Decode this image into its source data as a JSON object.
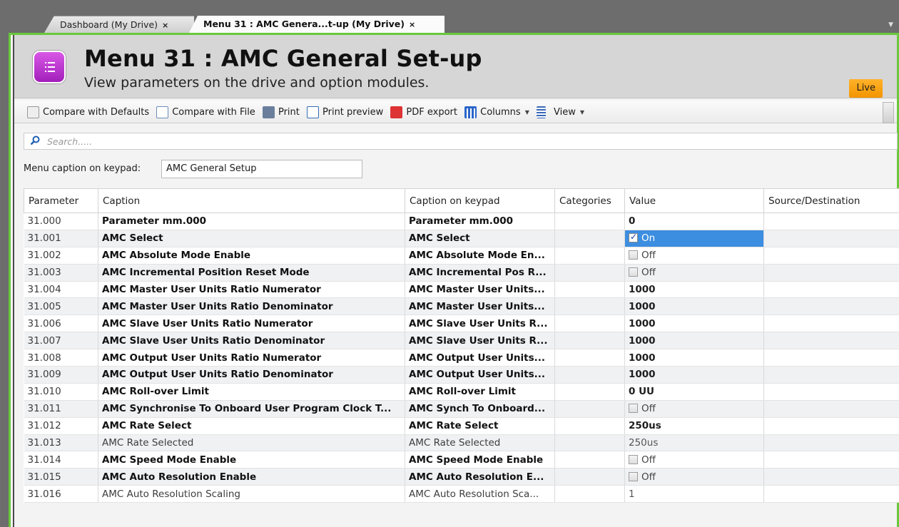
{
  "tabs": [
    {
      "label": "Dashboard (My Drive)",
      "close": "×",
      "active": false
    },
    {
      "label": "Menu 31 : AMC Genera...t-up (My Drive)",
      "close": "×",
      "active": true
    }
  ],
  "header": {
    "title": "Menu 31 : AMC General Set-up",
    "subtitle": "View parameters on the drive and option modules.",
    "icon": "menu-list-icon",
    "badge": "Live"
  },
  "colors": {
    "accent_green": "#69c93b",
    "live_orange": "#f29400",
    "selection_blue": "#3c8ee0",
    "icon_purple": "#b02bc8"
  },
  "toolbar": {
    "compare_defaults": "Compare with Defaults",
    "compare_file": "Compare with File",
    "print": "Print",
    "print_preview": "Print preview",
    "pdf_export": "PDF export",
    "columns": "Columns",
    "view": "View"
  },
  "search": {
    "placeholder": "Search....."
  },
  "menu_caption": {
    "label": "Menu caption on keypad:",
    "value": "AMC General Setup"
  },
  "table": {
    "columns": [
      "Parameter",
      "Caption",
      "Caption on keypad",
      "Categories",
      "Value",
      "Source/Destination"
    ],
    "rows": [
      {
        "param": "31.000",
        "caption": "Parameter mm.000",
        "keypad": "Parameter mm.000",
        "categories": "",
        "value": "0",
        "type": "num",
        "bold": true
      },
      {
        "param": "31.001",
        "caption": "AMC Select",
        "keypad": "AMC Select",
        "categories": "",
        "value": "On",
        "type": "check-on",
        "bold": true,
        "selected": true
      },
      {
        "param": "31.002",
        "caption": "AMC Absolute Mode Enable",
        "keypad": "AMC Absolute Mode En...",
        "categories": "",
        "value": "Off",
        "type": "check-off",
        "bold": true
      },
      {
        "param": "31.003",
        "caption": "AMC Incremental Position Reset Mode",
        "keypad": "AMC Incremental Pos R...",
        "categories": "",
        "value": "Off",
        "type": "check-off",
        "bold": true
      },
      {
        "param": "31.004",
        "caption": "AMC Master User Units Ratio Numerator",
        "keypad": "AMC Master User Units...",
        "categories": "",
        "value": "1000",
        "type": "num",
        "bold": true
      },
      {
        "param": "31.005",
        "caption": "AMC Master User Units Ratio Denominator",
        "keypad": "AMC Master User Units...",
        "categories": "",
        "value": "1000",
        "type": "num",
        "bold": true
      },
      {
        "param": "31.006",
        "caption": "AMC Slave User Units Ratio Numerator",
        "keypad": "AMC Slave User Units R...",
        "categories": "",
        "value": "1000",
        "type": "num",
        "bold": true
      },
      {
        "param": "31.007",
        "caption": "AMC Slave User Units Ratio Denominator",
        "keypad": "AMC Slave User Units R...",
        "categories": "",
        "value": "1000",
        "type": "num",
        "bold": true
      },
      {
        "param": "31.008",
        "caption": "AMC Output User Units Ratio Numerator",
        "keypad": "AMC Output User Units...",
        "categories": "",
        "value": "1000",
        "type": "num",
        "bold": true
      },
      {
        "param": "31.009",
        "caption": "AMC Output User Units Ratio Denominator",
        "keypad": "AMC Output User Units...",
        "categories": "",
        "value": "1000",
        "type": "num",
        "bold": true
      },
      {
        "param": "31.010",
        "caption": "AMC Roll-over Limit",
        "keypad": "AMC Roll-over Limit",
        "categories": "",
        "value": "0 UU",
        "type": "num",
        "bold": true
      },
      {
        "param": "31.011",
        "caption": "AMC Synchronise To Onboard User Program Clock T...",
        "keypad": "AMC Synch To Onboard...",
        "categories": "",
        "value": "Off",
        "type": "check-off",
        "bold": true
      },
      {
        "param": "31.012",
        "caption": "AMC Rate Select",
        "keypad": "AMC Rate Select",
        "categories": "",
        "value": "250us",
        "type": "num",
        "bold": true
      },
      {
        "param": "31.013",
        "caption": "AMC Rate Selected",
        "keypad": "AMC Rate Selected",
        "categories": "",
        "value": "250us",
        "type": "plain",
        "bold": false
      },
      {
        "param": "31.014",
        "caption": "AMC Speed Mode Enable",
        "keypad": "AMC Speed Mode Enable",
        "categories": "",
        "value": "Off",
        "type": "check-off",
        "bold": true
      },
      {
        "param": "31.015",
        "caption": "AMC Auto Resolution Enable",
        "keypad": "AMC Auto Resolution E...",
        "categories": "",
        "value": "Off",
        "type": "check-off",
        "bold": true
      },
      {
        "param": "31.016",
        "caption": "AMC Auto Resolution Scaling",
        "keypad": "AMC Auto Resolution Sca...",
        "categories": "",
        "value": "1",
        "type": "plain",
        "bold": false
      }
    ]
  }
}
